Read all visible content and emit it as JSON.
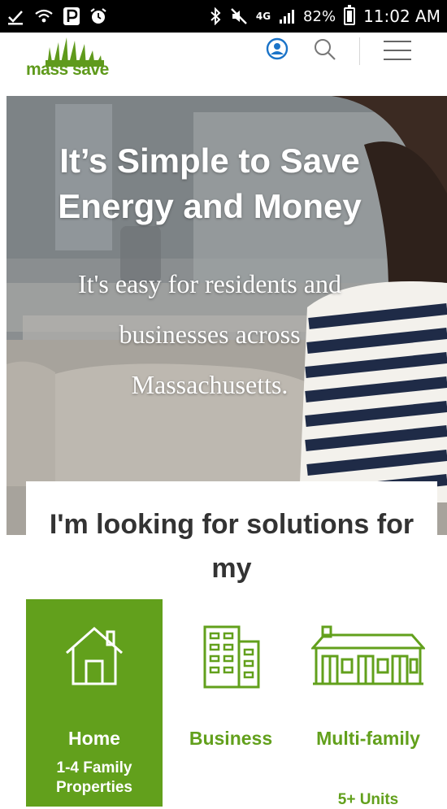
{
  "status_bar": {
    "network": "4G",
    "battery_percent": "82%",
    "time": "11:02 AM",
    "battery_level": 0.82
  },
  "header": {
    "logo_text": "mass save",
    "account_icon": "account-icon",
    "search_icon": "search-icon",
    "menu_icon": "menu-icon",
    "brand_color": "#5f9a1c"
  },
  "hero": {
    "title": "It’s Simple to Save Energy and Money",
    "subtitle": "It's easy for residents and businesses across Massachusetts."
  },
  "solutions": {
    "title": "I'm looking for solutions for my",
    "accent_color": "#62a01c",
    "options": [
      {
        "label": "Home",
        "sublabel": "1-4 Family Properties",
        "icon": "house-icon",
        "selected": true
      },
      {
        "label": "Business",
        "icon": "building-icon",
        "selected": false
      },
      {
        "label": "Multi-family",
        "sublabel": "5+ Units",
        "icon": "multifamily-icon",
        "selected": false
      }
    ]
  }
}
